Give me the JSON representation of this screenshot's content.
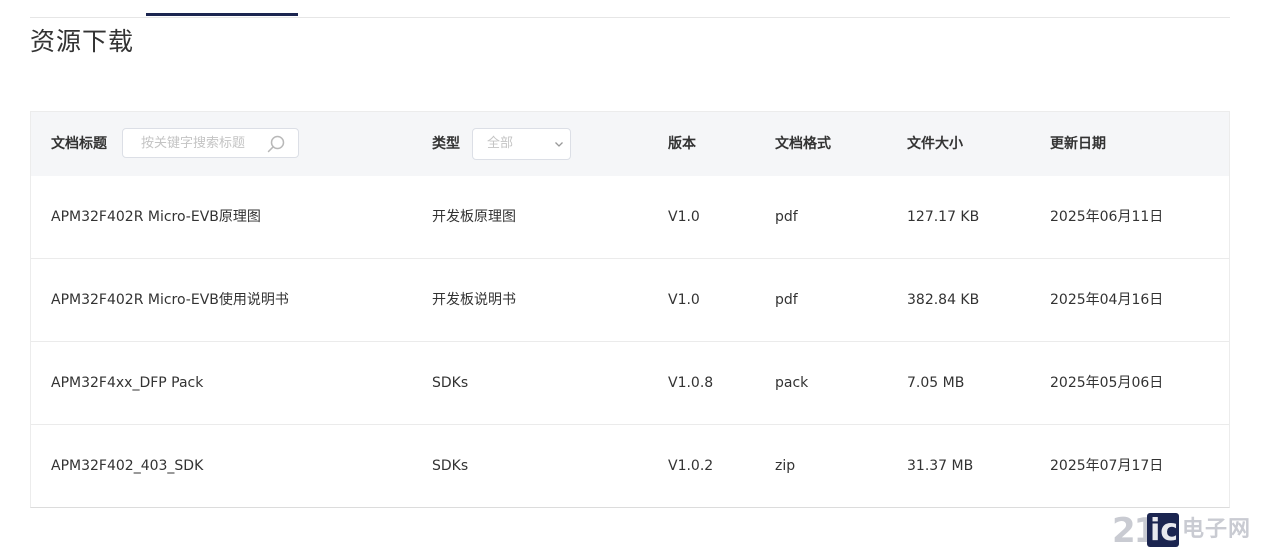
{
  "page": {
    "title": "资源下载"
  },
  "table": {
    "headers": {
      "title": "文档标题",
      "type": "类型",
      "version": "版本",
      "format": "文档格式",
      "size": "文件大小",
      "date": "更新日期"
    },
    "search": {
      "placeholder": "按关键字搜索标题",
      "value": ""
    },
    "type_filter": {
      "selected": "全部"
    },
    "rows": [
      {
        "title": "APM32F402R Micro-EVB原理图",
        "type": "开发板原理图",
        "version": "V1.0",
        "format": "pdf",
        "size": "127.17 KB",
        "date": "2025年06月11日"
      },
      {
        "title": "APM32F402R Micro-EVB使用说明书",
        "type": "开发板说明书",
        "version": "V1.0",
        "format": "pdf",
        "size": "382.84 KB",
        "date": "2025年04月16日"
      },
      {
        "title": "APM32F4xx_DFP Pack",
        "type": "SDKs",
        "version": "V1.0.8",
        "format": "pack",
        "size": "7.05 MB",
        "date": "2025年05月06日"
      },
      {
        "title": "APM32F402_403_SDK",
        "type": "SDKs",
        "version": "V1.0.2",
        "format": "zip",
        "size": "31.37 MB",
        "date": "2025年07月17日"
      }
    ]
  },
  "watermark": {
    "brand_num": "21",
    "brand_ic": "ic",
    "brand_cn": "电子网"
  },
  "colors": {
    "accent": "#1b2550",
    "header_bg": "#f5f6f8",
    "placeholder": "#c4c4c4"
  }
}
